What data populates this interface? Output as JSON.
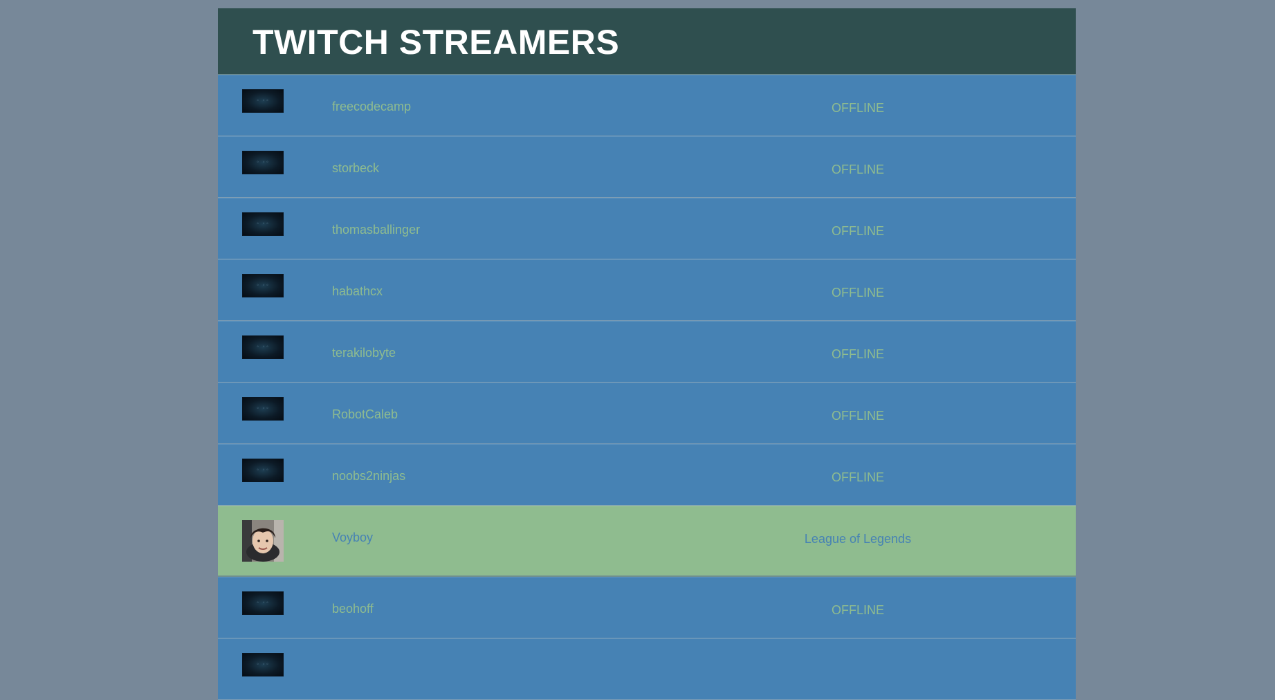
{
  "header": {
    "title": "TWITCH STREAMERS"
  },
  "colors": {
    "page_background": "#778899",
    "header_background": "#2f4f4f",
    "offline_row": "#4682b4",
    "online_row": "#8fbc8f",
    "offline_text": "#8fbc8f",
    "online_text": "#4682b4"
  },
  "streamers": [
    {
      "name": "freecodecamp",
      "status": "OFFLINE",
      "logo_icon": "twitch-offline-logo-icon",
      "online": false
    },
    {
      "name": "storbeck",
      "status": "OFFLINE",
      "logo_icon": "twitch-offline-logo-icon",
      "online": false
    },
    {
      "name": "thomasballinger",
      "status": "OFFLINE",
      "logo_icon": "twitch-offline-logo-icon",
      "online": false
    },
    {
      "name": "habathcx",
      "status": "OFFLINE",
      "logo_icon": "twitch-offline-logo-icon",
      "online": false
    },
    {
      "name": "terakilobyte",
      "status": "OFFLINE",
      "logo_icon": "twitch-offline-logo-icon",
      "online": false
    },
    {
      "name": "RobotCaleb",
      "status": "OFFLINE",
      "logo_icon": "twitch-offline-logo-icon",
      "online": false
    },
    {
      "name": "noobs2ninjas",
      "status": "OFFLINE",
      "logo_icon": "twitch-offline-logo-icon",
      "online": false
    },
    {
      "name": "Voyboy",
      "status": "League of Legends",
      "logo_icon": "streamer-avatar-icon",
      "online": true
    },
    {
      "name": "beohoff",
      "status": "OFFLINE",
      "logo_icon": "twitch-offline-logo-icon",
      "online": false
    },
    {
      "name": "",
      "status": "",
      "logo_icon": "twitch-offline-logo-icon",
      "online": false
    }
  ]
}
